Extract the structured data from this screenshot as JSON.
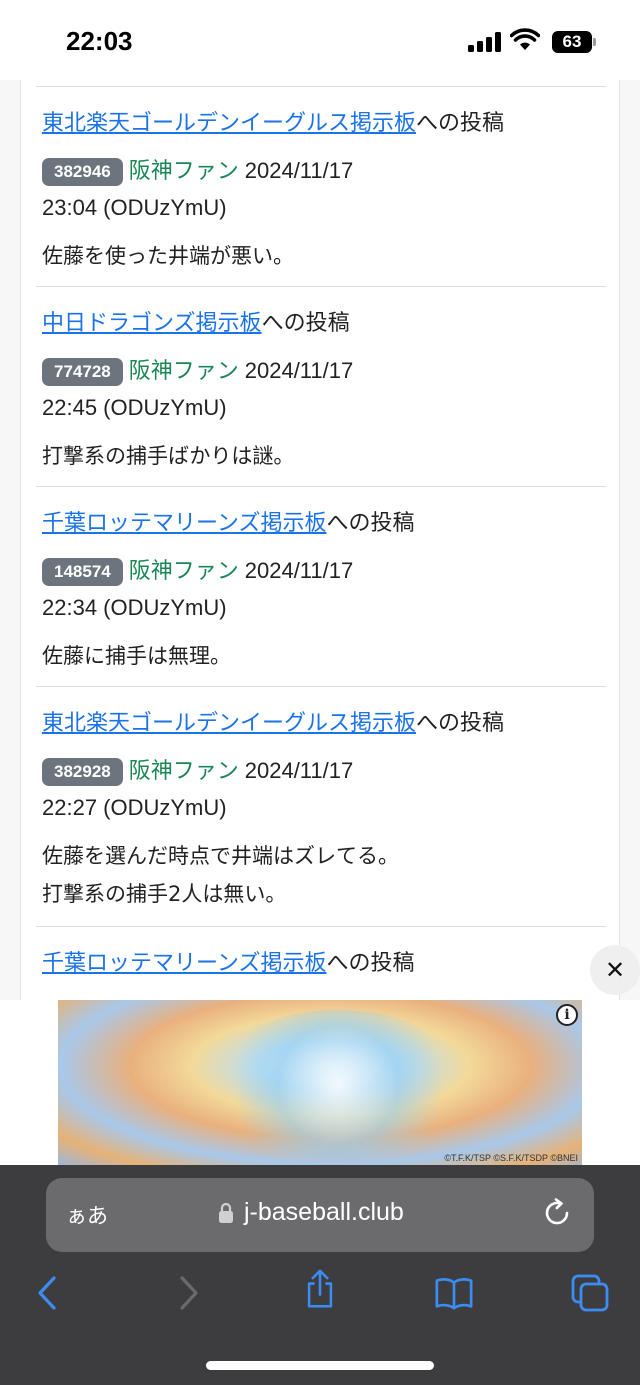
{
  "status_bar": {
    "time": "22:03",
    "battery": "63"
  },
  "posts": [
    {
      "board": "東北楽天ゴールデンイーグルス掲示板",
      "suffix": "への投稿",
      "id": "382946",
      "author": "阪神ファン",
      "date": "2024/11/17",
      "time": "23:04 (ODUzYmU)",
      "lines": [
        "佐藤を使った井端が悪い。"
      ]
    },
    {
      "board": "中日ドラゴンズ掲示板",
      "suffix": "への投稿",
      "id": "774728",
      "author": "阪神ファン",
      "date": "2024/11/17",
      "time": "22:45 (ODUzYmU)",
      "lines": [
        "打撃系の捕手ばかりは謎。"
      ]
    },
    {
      "board": "千葉ロッテマリーンズ掲示板",
      "suffix": "への投稿",
      "id": "148574",
      "author": "阪神ファン",
      "date": "2024/11/17",
      "time": "22:34 (ODUzYmU)",
      "lines": [
        "佐藤に捕手は無理。"
      ]
    },
    {
      "board": "東北楽天ゴールデンイーグルス掲示板",
      "suffix": "への投稿",
      "id": "382928",
      "author": "阪神ファン",
      "date": "2024/11/17",
      "time": "22:27 (ODUzYmU)",
      "lines": [
        "佐藤を選んだ時点で井端はズレてる。",
        "打撃系の捕手2人は無い。"
      ]
    },
    {
      "board": "千葉ロッテマリーンズ掲示板",
      "suffix": "への投稿"
    }
  ],
  "ad": {
    "close_label": "✕",
    "info_label": "i",
    "copyright": "©T.F.K/TSP ©S.F.K/TSDP ©BNEI"
  },
  "browser": {
    "aa_label": "ぁあ",
    "url": "j-baseball.club"
  },
  "colors": {
    "link": "#1a73e8",
    "author": "#198754",
    "badge": "#6c757d",
    "toolbar": "#3d3d3f",
    "toolbar_icon": "#3b8cf5"
  },
  "icons": [
    "back-icon",
    "forward-icon",
    "share-icon",
    "bookmarks-icon",
    "tabs-icon",
    "reload-icon",
    "lock-icon"
  ]
}
